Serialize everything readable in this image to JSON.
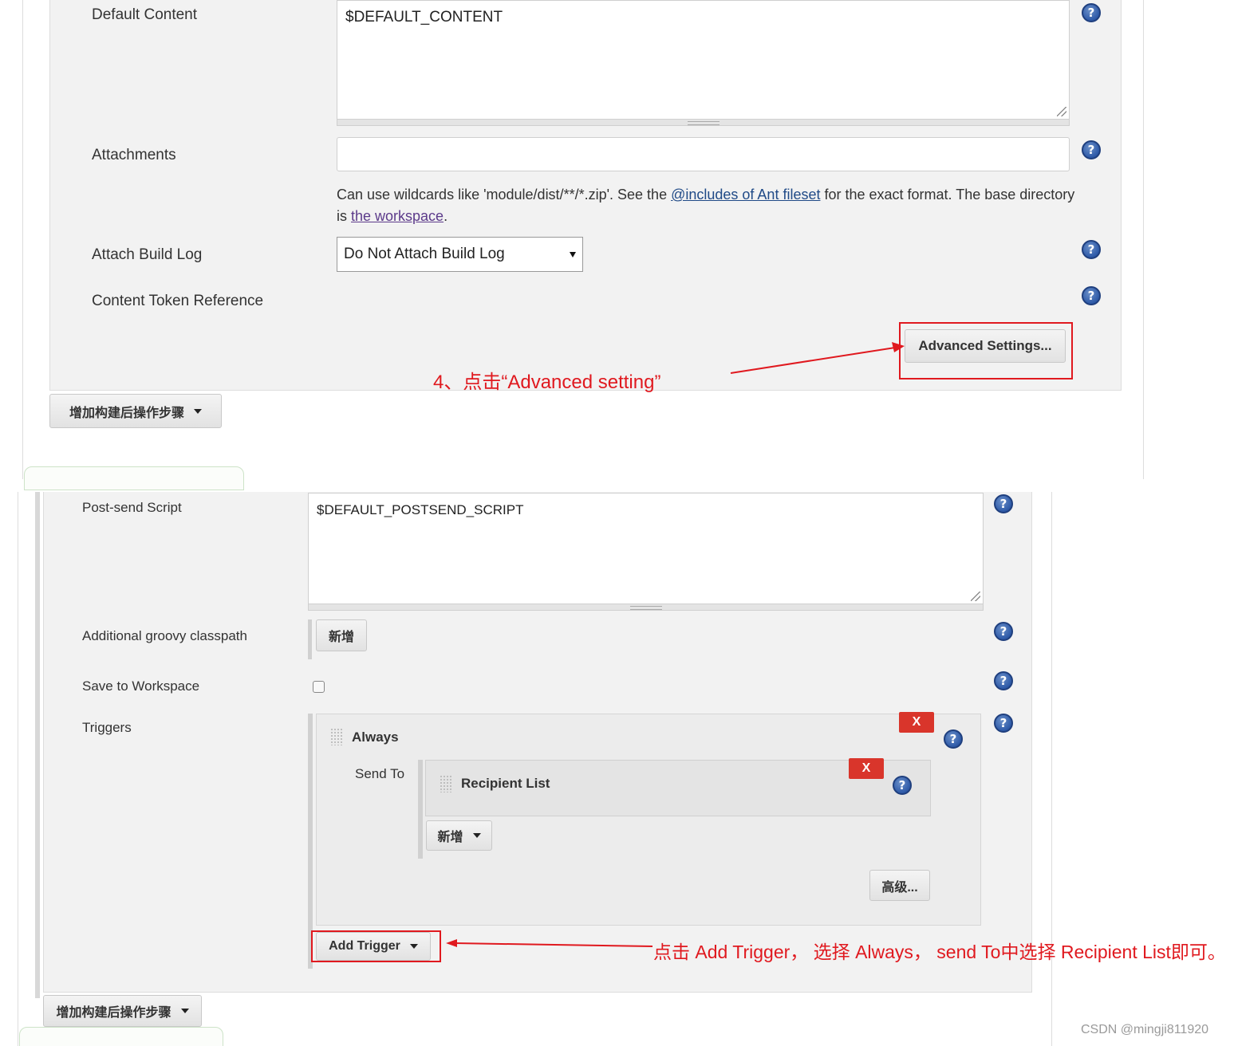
{
  "top": {
    "default_content_label": "Default Content",
    "default_content_value": "$DEFAULT_CONTENT",
    "attachments_label": "Attachments",
    "attachments_value": "",
    "help_text_pre": "Can use wildcards like 'module/dist/**/*.zip'. See the ",
    "help_text_link1": "@includes of Ant fileset",
    "help_text_mid": " for the exact format. The base directory is ",
    "help_text_link2": "the workspace",
    "help_text_post": ".",
    "attach_build_log_label": "Attach Build Log",
    "attach_build_log_value": "Do Not Attach Build Log",
    "content_token_label": "Content Token Reference",
    "advanced_settings_label": "Advanced Settings...",
    "annotation": "4、点击“Advanced setting”",
    "add_post_build_label": "增加构建后操作步骤"
  },
  "bottom": {
    "post_send_label": "Post-send Script",
    "post_send_value": "$DEFAULT_POSTSEND_SCRIPT",
    "groovy_label": "Additional groovy classpath",
    "groovy_add_label": "新增",
    "save_workspace_label": "Save to Workspace",
    "triggers_label": "Triggers",
    "always_label": "Always",
    "x_label": "X",
    "send_to_label": "Send To",
    "recipient_list_label": "Recipient List",
    "add_recipient_label": "新增",
    "advanced_label": "高级...",
    "add_trigger_label": "Add Trigger",
    "annotation": "点击 Add Trigger， 选择 Always， send To中选择 Recipient List即可。",
    "add_post_build_label": "增加构建后操作步骤"
  },
  "help_glyph": "?",
  "watermark": "CSDN @mingji811920",
  "colors": {
    "annotation_red": "#e0191f",
    "delete_red": "#d9352b",
    "help_blue": "#2e5aa8"
  }
}
